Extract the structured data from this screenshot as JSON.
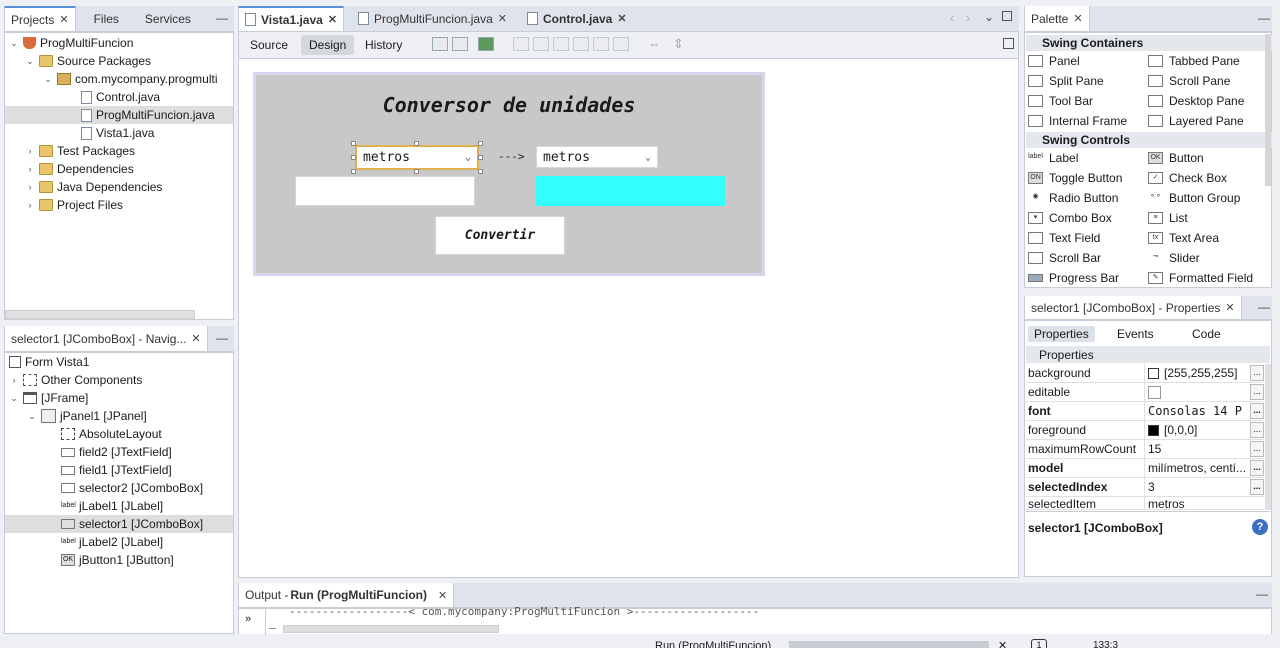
{
  "projects_panel": {
    "tabs": [
      {
        "label": "Projects",
        "active": true
      },
      {
        "label": "Files"
      },
      {
        "label": "Services"
      }
    ],
    "tree": [
      {
        "label": "ProgMultiFuncion",
        "level": 0,
        "icon": "coffee-cup-icon",
        "expanded": true
      },
      {
        "label": "Source Packages",
        "level": 1,
        "icon": "folder-icon",
        "expanded": true
      },
      {
        "label": "com.mycompany.progmulti",
        "level": 2,
        "icon": "package-icon",
        "expanded": true
      },
      {
        "label": "Control.java",
        "level": 3,
        "icon": "java-file-icon"
      },
      {
        "label": "ProgMultiFuncion.java",
        "level": 3,
        "icon": "java-file-icon",
        "selected": true
      },
      {
        "label": "Vista1.java",
        "level": 3,
        "icon": "java-file-icon"
      },
      {
        "label": "Test Packages",
        "level": 1,
        "icon": "folder-icon"
      },
      {
        "label": "Dependencies",
        "level": 1,
        "icon": "folder-icon"
      },
      {
        "label": "Java Dependencies",
        "level": 1,
        "icon": "folder-icon"
      },
      {
        "label": "Project Files",
        "level": 1,
        "icon": "folder-icon"
      }
    ]
  },
  "navigator_panel": {
    "title": "selector1 [JComboBox] - Navig...",
    "tree": [
      {
        "label": "Form Vista1",
        "level": 0
      },
      {
        "label": "Other Components",
        "level": 0
      },
      {
        "label": "[JFrame]",
        "level": 0
      },
      {
        "label": "jPanel1 [JPanel]",
        "level": 1
      },
      {
        "label": "AbsoluteLayout",
        "level": 2
      },
      {
        "label": "field2 [JTextField]",
        "level": 2
      },
      {
        "label": "field1 [JTextField]",
        "level": 2
      },
      {
        "label": "selector2 [JComboBox]",
        "level": 2
      },
      {
        "label": "jLabel1 [JLabel]",
        "level": 2
      },
      {
        "label": "selector1 [JComboBox]",
        "level": 2,
        "selected": true
      },
      {
        "label": "jLabel2 [JLabel]",
        "level": 2
      },
      {
        "label": "jButton1 [JButton]",
        "level": 2
      }
    ]
  },
  "editor": {
    "tabs": [
      {
        "label": "Vista1.java",
        "active": true
      },
      {
        "label": "ProgMultiFuncion.java"
      },
      {
        "label": "Control.java"
      }
    ],
    "modes": {
      "source": "Source",
      "design": "Design",
      "history": "History"
    },
    "form": {
      "title": "Conversor de unidades",
      "selector1_value": "metros",
      "arrow_label": "--->",
      "selector2_value": "metros",
      "button_label": "Convertir",
      "output_color": "#33ffff"
    }
  },
  "palette": {
    "title": "Palette",
    "containers_header": "Swing Containers",
    "containers": [
      "Panel",
      "Tabbed Pane",
      "Split Pane",
      "Scroll Pane",
      "Tool Bar",
      "Desktop Pane",
      "Internal Frame",
      "Layered Pane"
    ],
    "controls_header": "Swing Controls",
    "controls": [
      "Label",
      "Button",
      "Toggle Button",
      "Check Box",
      "Radio Button",
      "Button Group",
      "Combo Box",
      "List",
      "Text Field",
      "Text Area",
      "Scroll Bar",
      "Slider",
      "Progress Bar",
      "Formatted Field"
    ]
  },
  "properties": {
    "title": "selector1 [JComboBox] - Properties",
    "tabs": [
      "Properties",
      "Events",
      "Code"
    ],
    "section": "Properties",
    "rows": [
      {
        "key": "background",
        "value": "[255,255,255]",
        "swatch": "#ffffff"
      },
      {
        "key": "editable",
        "value": "",
        "checkbox": true
      },
      {
        "key": "font",
        "value": "Consolas 14 P",
        "bold": true
      },
      {
        "key": "foreground",
        "value": "[0,0,0]",
        "swatch": "#000000"
      },
      {
        "key": "maximumRowCount",
        "value": "15"
      },
      {
        "key": "model",
        "value": "milímetros, centí...",
        "bold": true
      },
      {
        "key": "selectedIndex",
        "value": "3",
        "bold": true
      },
      {
        "key": "selectedItem",
        "value": "metros"
      }
    ],
    "footer": "selector1 [JComboBox]"
  },
  "output": {
    "title_prefix": "Output - ",
    "title_bold": "Run (ProgMultiFuncion)",
    "line": "------------------< com.mycompany:ProgMultiFuncion >-------------------",
    "cursor": "_"
  },
  "status": {
    "run_label": "Run (ProgMultiFuncion)",
    "notifications": "1",
    "position": "133:3"
  }
}
